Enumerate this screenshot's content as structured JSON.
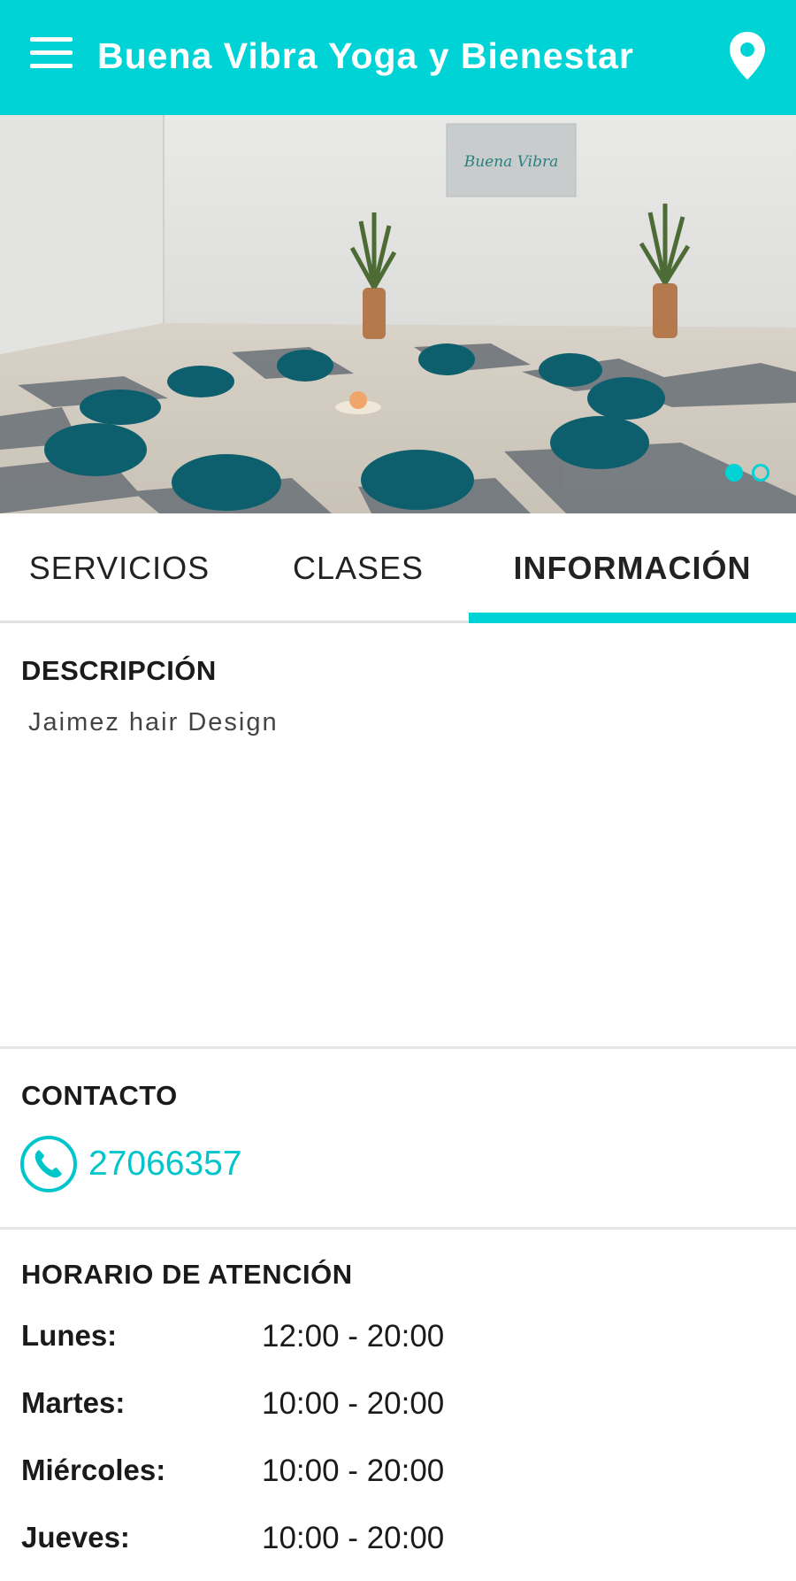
{
  "app_bar": {
    "title": "Buena Vibra Yoga y Bienestar",
    "menu_icon": "hamburger-menu-icon",
    "location_icon": "location-pin-icon",
    "background_color": "#00d3d6"
  },
  "hero": {
    "sign_text": "Buena Vibra",
    "carousel": {
      "total": 2,
      "active": 1
    }
  },
  "tabs": [
    {
      "label": "SERVICIOS",
      "active": false
    },
    {
      "label": "CLASES",
      "active": false
    },
    {
      "label": "INFORMACIÓN",
      "active": true
    }
  ],
  "description": {
    "title": "DESCRIPCIÓN",
    "text": "Jaimez hair Design"
  },
  "contact": {
    "title": "CONTACTO",
    "phone": "27066357",
    "phone_icon": "phone-icon"
  },
  "hours": {
    "title": "HORARIO DE ATENCIÓN",
    "rows": [
      {
        "day": "Lunes:",
        "time": "12:00 - 20:00"
      },
      {
        "day": "Martes:",
        "time": "10:00 - 20:00"
      },
      {
        "day": "Miércoles:",
        "time": "10:00 - 20:00"
      },
      {
        "day": "Jueves:",
        "time": "10:00 - 20:00"
      }
    ]
  },
  "colors": {
    "accent": "#00d3d6",
    "text": "#1a1a1a",
    "divider": "#e6e6e6"
  }
}
